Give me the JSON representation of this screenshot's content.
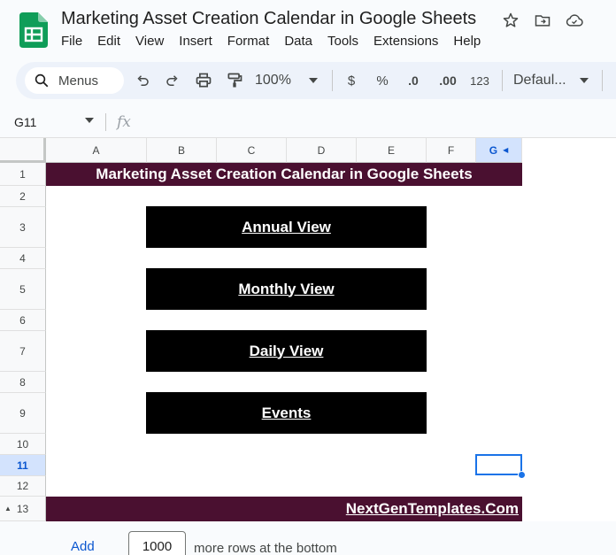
{
  "document": {
    "title": "Marketing Asset Creation Calendar in Google Sheets"
  },
  "menu": [
    "File",
    "Edit",
    "View",
    "Insert",
    "Format",
    "Data",
    "Tools",
    "Extensions",
    "Help"
  ],
  "toolbar": {
    "search_label": "Menus",
    "zoom": "100%",
    "currency": "$",
    "percent": "%",
    "decrease_decimal": ".0",
    "increase_decimal": ".00",
    "number_format": "123",
    "font": "Defaul..."
  },
  "formula_bar": {
    "cell_ref": "G11",
    "fx": "fx",
    "value": ""
  },
  "columns": [
    "A",
    "B",
    "C",
    "D",
    "E",
    "F",
    "G"
  ],
  "rows": [
    "1",
    "2",
    "3",
    "4",
    "5",
    "6",
    "7",
    "8",
    "9",
    "10",
    "11",
    "12",
    "13"
  ],
  "selected": {
    "column": "G",
    "row": "11"
  },
  "sheet": {
    "header": "Marketing Asset Creation Calendar in Google Sheets",
    "buttons": {
      "annual": "Annual View",
      "monthly": "Monthly View",
      "daily": "Daily View",
      "events": "Events"
    },
    "footer_link": "NextGenTemplates.Com"
  },
  "add_rows": {
    "link": "Add",
    "count": "1000",
    "suffix": "more rows at the bottom"
  },
  "colors": {
    "banner": "#4a1030",
    "button": "#000000",
    "selection": "#1a73e8",
    "accent": "#0b57d0"
  }
}
